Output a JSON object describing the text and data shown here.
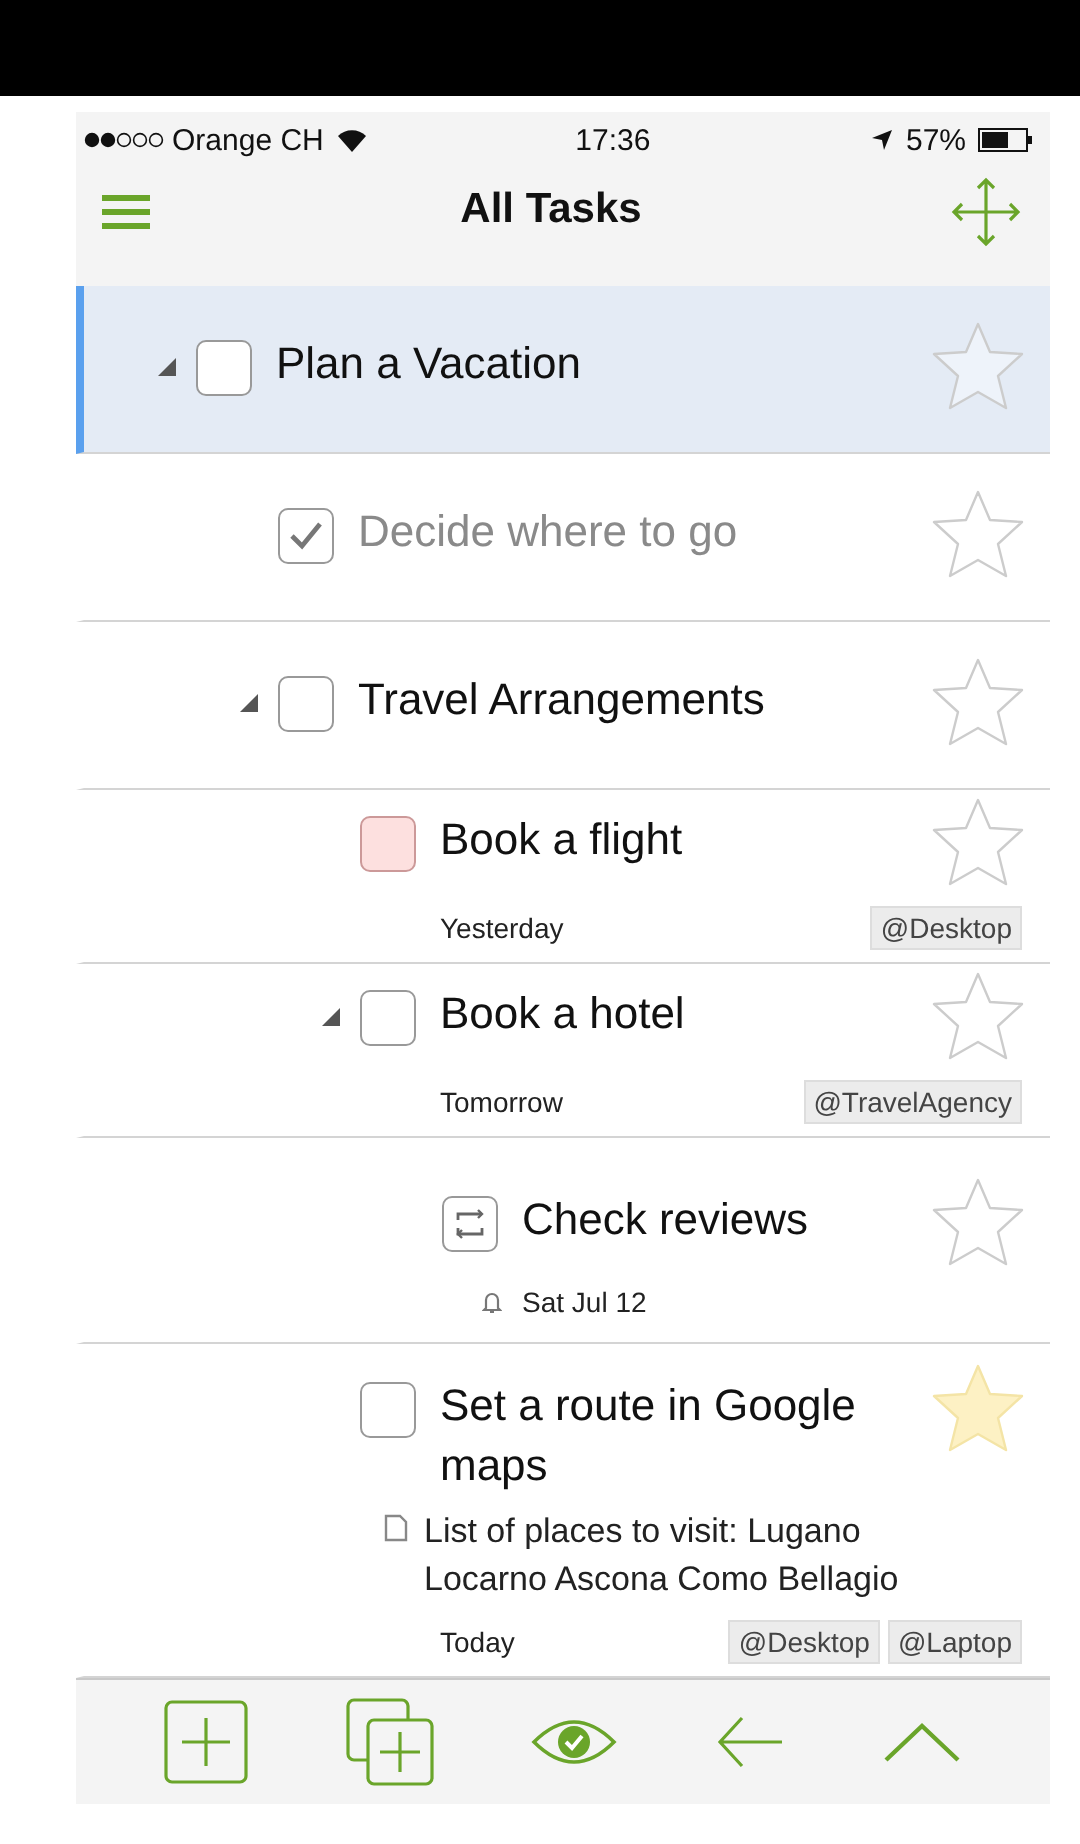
{
  "status_bar": {
    "carrier": "Orange CH",
    "time": "17:36",
    "battery": "57%"
  },
  "nav": {
    "title": "All Tasks"
  },
  "tasks": [
    {
      "title": "Plan a Vacation",
      "kind": "open",
      "selected": true,
      "expanded": true,
      "flagged": false,
      "children": [
        {
          "title": "Decide where to go",
          "kind": "done",
          "selected": false,
          "flagged": false
        },
        {
          "title": "Travel Arrangements",
          "kind": "open",
          "selected": false,
          "expanded": true,
          "flagged": false,
          "children": [
            {
              "title": "Book a flight",
              "kind": "overdue",
              "selected": false,
              "flagged": false,
              "date": "Yesterday",
              "tags": [
                "@Desktop"
              ]
            },
            {
              "title": "Book a hotel",
              "kind": "open",
              "selected": false,
              "expanded": true,
              "flagged": false,
              "date": "Tomorrow",
              "tags": [
                "@TravelAgency"
              ],
              "children": [
                {
                  "title": "Check reviews",
                  "kind": "repeat",
                  "selected": false,
                  "flagged": false,
                  "reminder": "Sat Jul 12"
                }
              ]
            },
            {
              "title": "Set a route in Google maps",
              "kind": "open",
              "selected": false,
              "flagged": true,
              "note": "List of places to visit: Lugano Locarno Ascona Como Bellagio",
              "date": "Today",
              "tags": [
                "@Desktop",
                "@Laptop"
              ]
            }
          ]
        }
      ]
    }
  ]
}
